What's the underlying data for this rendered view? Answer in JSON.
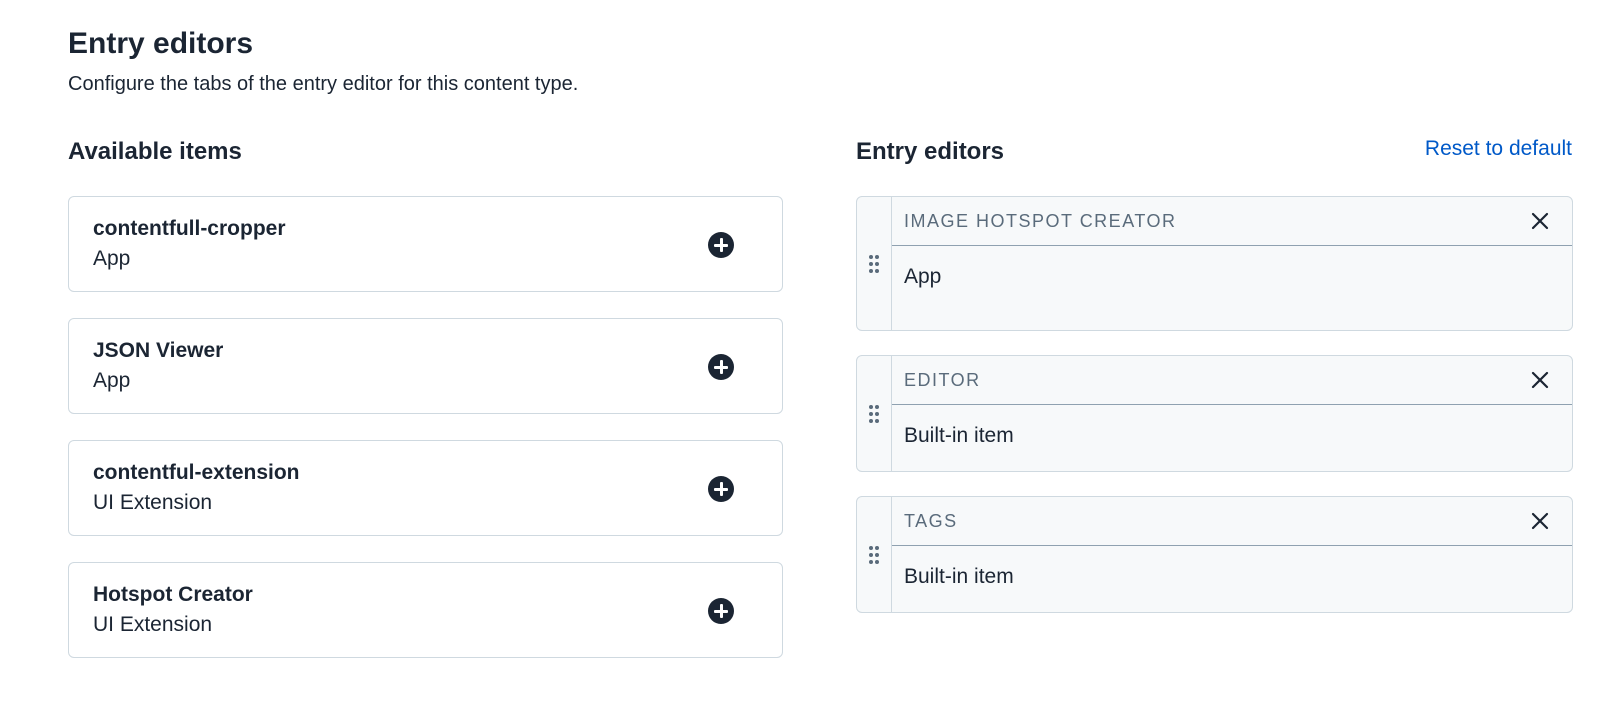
{
  "page": {
    "title": "Entry editors",
    "subtitle": "Configure the tabs of the entry editor for this content type."
  },
  "available": {
    "heading": "Available items",
    "items": [
      {
        "name": "contentfull-cropper",
        "type": "App",
        "action_icon": "plus-circle-icon"
      },
      {
        "name": "JSON Viewer",
        "type": "App",
        "action_icon": "plus-circle-icon"
      },
      {
        "name": "contentful-extension",
        "type": "UI Extension",
        "action_icon": "plus-circle-icon"
      },
      {
        "name": "Hotspot Creator",
        "type": "UI Extension",
        "action_icon": "plus-circle-icon"
      }
    ]
  },
  "editors": {
    "heading": "Entry editors",
    "reset_label": "Reset to default",
    "items": [
      {
        "title": "IMAGE HOTSPOT CREATOR",
        "type": "App",
        "handle_icon": "drag-handle-icon",
        "remove_icon": "close-icon"
      },
      {
        "title": "EDITOR",
        "type": "Built-in item",
        "handle_icon": "drag-handle-icon",
        "remove_icon": "close-icon"
      },
      {
        "title": "TAGS",
        "type": "Built-in item",
        "handle_icon": "drag-handle-icon",
        "remove_icon": "close-icon"
      }
    ]
  },
  "colors": {
    "text": "#1b2533",
    "link": "#0059c8",
    "border": "#cfd9e0",
    "card_muted_bg": "#f7f9fa",
    "muted_text": "#5a6b7b"
  }
}
